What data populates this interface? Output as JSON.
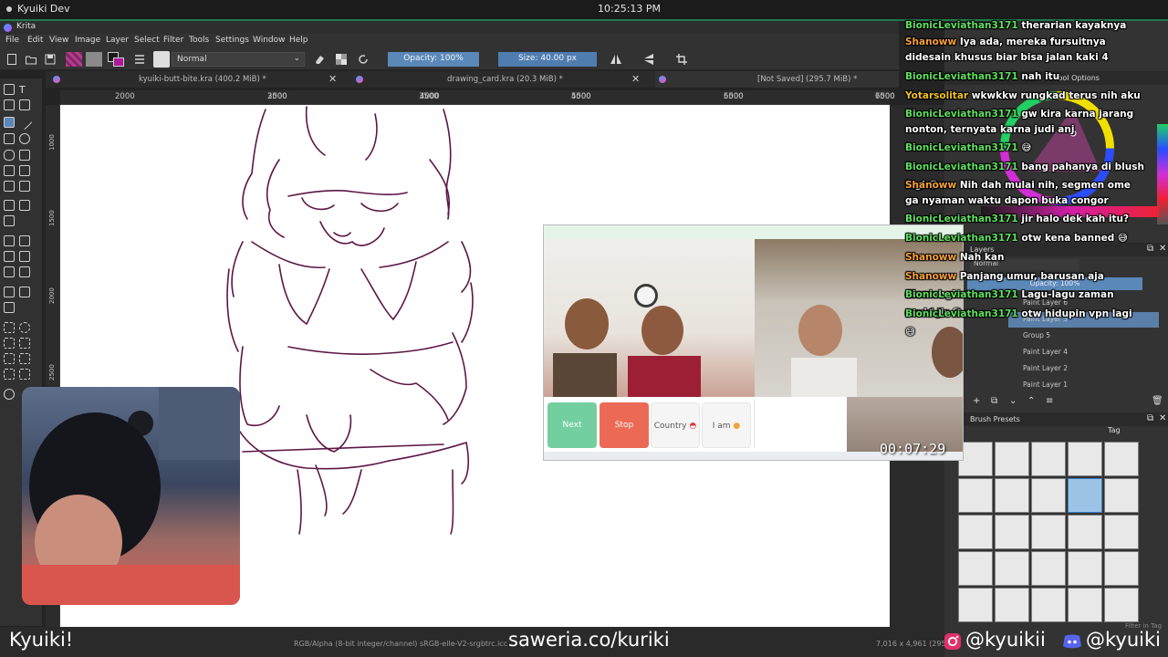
{
  "system_bar": {
    "title": "Kyuiki Dev",
    "clock": "10:25:13 PM"
  },
  "krita": {
    "window_title": "Krita",
    "menu": [
      "File",
      "Edit",
      "View",
      "Image",
      "Layer",
      "Select",
      "Filter",
      "Tools",
      "Settings",
      "Window",
      "Help"
    ],
    "blend_mode": "Normal",
    "opacity_label": "Opacity: 100%",
    "size_label": "Size: 40.00 px",
    "tabs": [
      {
        "label": "kyuiki-butt-bite.kra (400.2 MiB) *"
      },
      {
        "label": "drawing_card.kra (20.3 MiB) *"
      },
      {
        "label": "[Not Saved]  (295.7 MiB) *"
      }
    ],
    "ruler_top": [
      "2000",
      "2500",
      "3000",
      "3500",
      "4000",
      "4500",
      "5000",
      "5500",
      "6000",
      "6500",
      "7000"
    ],
    "ruler_left": [
      "1000",
      "1500",
      "2000",
      "2500"
    ],
    "status_color_space": "RGB/Alpha (8-bit integer/channel)  sRGB-elle-V2-srgbtrc.icc",
    "status_coords": "7,016 x 4,961 (295"
  },
  "docker": {
    "tool_options_label": "Tool Options",
    "layers_label": "Layers",
    "layers_mode": "Normal",
    "layers_opacity": "Opacity:  100%",
    "layers": [
      "Paint Layer 6",
      "Paint Layer 3",
      "Group 5",
      "Paint Layer 4",
      "Paint Layer 2",
      "Paint Layer 1"
    ],
    "brush_presets_label": "Brush Presets",
    "tag_label": "Tag",
    "filter_label": "Filter in Tag"
  },
  "chat": [
    {
      "user": "BionicLeviathan3171",
      "color": "#5fe05f",
      "message": "therarian kayaknya"
    },
    {
      "user": "Shanoww",
      "color": "#f7a035",
      "message": "Iya ada, mereka fursuitnya didesain khusus biar bisa jalan kaki 4"
    },
    {
      "user": "BionicLeviathan3171",
      "color": "#5fe05f",
      "message": "nah itu"
    },
    {
      "user": "Yotarsolitar",
      "color": "#f0c020",
      "message": "wkwkkw rungkad terus nih aku"
    },
    {
      "user": "BionicLeviathan3171",
      "color": "#5fe05f",
      "message": "gw kira karna jarang nonton, ternyata karna judi anj"
    },
    {
      "user": "BionicLeviathan3171",
      "color": "#5fe05f",
      "message": "😅"
    },
    {
      "user": "BionicLeviathan3171",
      "color": "#5fe05f",
      "message": "bang pahanya di blush lagi 😋"
    },
    {
      "user": "Shanoww",
      "color": "#f7a035",
      "message": "Nih dah mulai nih, segmen ome ga nyaman waktu dapon buka congor"
    },
    {
      "user": "BionicLeviathan3171",
      "color": "#5fe05f",
      "message": "jir halo dek kah itu?"
    },
    {
      "user": "BionicLeviathan3171",
      "color": "#5fe05f",
      "message": "otw kena banned 😅"
    },
    {
      "user": "Shanoww",
      "color": "#f7a035",
      "message": "Nah kan"
    },
    {
      "user": "Shanoww",
      "color": "#f7a035",
      "message": "Panjang umur, barusan aja diomongin"
    },
    {
      "user": "BionicLeviathan3171",
      "color": "#5fe05f",
      "message": "Lagu-lagu zaman covid jir 😮"
    },
    {
      "user": "BionicLeviathan3171",
      "color": "#5fe05f",
      "message": "otw hidupin vpn lagi 😅"
    }
  ],
  "video_call": {
    "buttons": [
      {
        "label": "Next",
        "color": "#74cfa0"
      },
      {
        "label": "Stop",
        "color": "#ec6a55"
      },
      {
        "label": "Country",
        "color": "#f5f5f5"
      },
      {
        "label": "I am",
        "color": "#f5f5f5"
      }
    ],
    "timer": "00:07:29"
  },
  "overlay": {
    "name": "Kyuiki!",
    "saweria": "saweria.co/kuriki",
    "instagram": "@kyuikii",
    "discord": "@kyuiki"
  }
}
